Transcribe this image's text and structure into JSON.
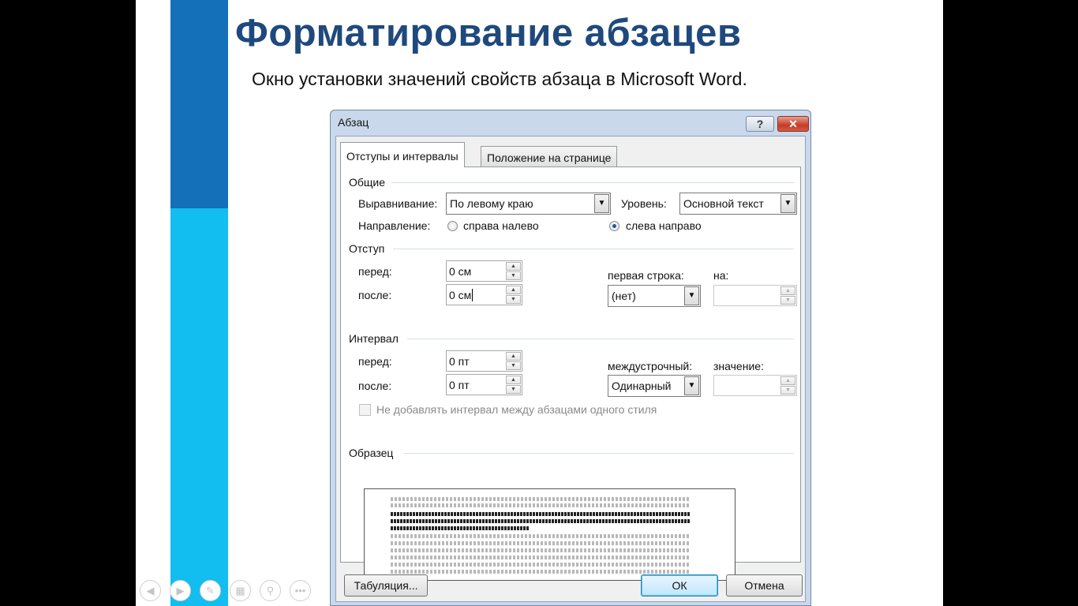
{
  "slide": {
    "title": "Форматирование абзацев",
    "subtitle": "Окно установки значений свойств абзаца в Microsoft Word.",
    "accent_dark": "#1470b8",
    "accent_light": "#12bdf0"
  },
  "dialog": {
    "title": "Абзац",
    "help_label": "?",
    "close_label": "✕",
    "tabs": [
      {
        "label": "Отступы и интервалы",
        "active": true
      },
      {
        "label": "Положение на странице",
        "active": false
      }
    ],
    "general": {
      "heading": "Общие",
      "alignment_label": "Выравнивание:",
      "alignment_value": "По левому краю",
      "level_label": "Уровень:",
      "level_value": "Основной текст",
      "direction_label": "Направление:",
      "rtl_label": "справа налево",
      "ltr_label": "слева направо",
      "selected_direction": "ltr"
    },
    "indent": {
      "heading": "Отступ",
      "before_label": "перед:",
      "before_value": "0 см",
      "after_label": "после:",
      "after_value": "0 см",
      "first_line_label": "первая строка:",
      "first_line_value": "(нет)",
      "by_label": "на:",
      "by_value": ""
    },
    "spacing": {
      "heading": "Интервал",
      "before_label": "перед:",
      "before_value": "0 пт",
      "after_label": "после:",
      "after_value": "0 пт",
      "line_label": "междустрочный:",
      "line_value": "Одинарный",
      "at_label": "значение:",
      "at_value": "",
      "no_space_label": "Не добавлять интервал между абзацами одного стиля",
      "no_space_checked": false
    },
    "preview": {
      "heading": "Образец"
    },
    "buttons": {
      "tabs": "Табуляция...",
      "ok": "ОК",
      "cancel": "Отмена"
    }
  },
  "presenter_toolbar": {
    "icons": [
      "back-icon",
      "forward-icon",
      "pen-icon",
      "slides-icon",
      "zoom-icon",
      "more-icon"
    ]
  }
}
